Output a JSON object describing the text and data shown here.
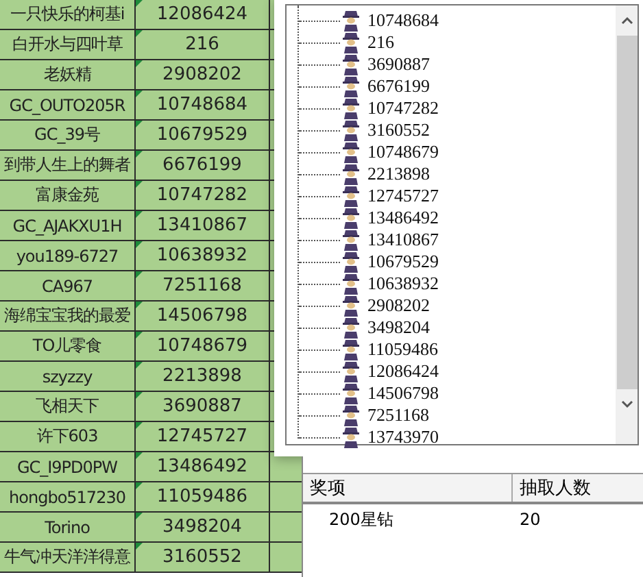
{
  "sheet": {
    "rows": [
      {
        "name": "一只快乐的柯基i",
        "id": "12086424"
      },
      {
        "name": "白开水与四叶草",
        "id": "216"
      },
      {
        "name": "老妖精",
        "id": "2908202"
      },
      {
        "name": "GC_OUTO205R",
        "id": "10748684"
      },
      {
        "name": "GC_39号",
        "id": "10679529"
      },
      {
        "name": "到带人生上的舞者",
        "id": "6676199"
      },
      {
        "name": "富康金苑",
        "id": "10747282"
      },
      {
        "name": "GC_AJAKXU1H",
        "id": "13410867"
      },
      {
        "name": "you189-6727",
        "id": "10638932"
      },
      {
        "name": "CA967",
        "id": "7251168"
      },
      {
        "name": "海绵宝宝我的最爱",
        "id": "14506798"
      },
      {
        "name": "TO儿零食",
        "id": "10748679"
      },
      {
        "name": "szyzzy",
        "id": "2213898"
      },
      {
        "name": "飞相天下",
        "id": "3690887"
      },
      {
        "name": "许下603",
        "id": "12745727"
      },
      {
        "name": "GC_I9PD0PW",
        "id": "13486492"
      },
      {
        "name": "hongbo517230",
        "id": "11059486"
      },
      {
        "name": "Torino",
        "id": "3498204"
      },
      {
        "name": "牛气冲天洋洋得意",
        "id": "3160552"
      }
    ]
  },
  "tree": {
    "items": [
      "10748684",
      "216",
      "3690887",
      "6676199",
      "10747282",
      "3160552",
      "10748679",
      "2213898",
      "12745727",
      "13486492",
      "13410867",
      "10679529",
      "10638932",
      "2908202",
      "3498204",
      "11059486",
      "12086424",
      "14506798",
      "7251168",
      "13743970"
    ]
  },
  "prizes": {
    "columns": [
      "奖项",
      "抽取人数"
    ],
    "rows": [
      {
        "prize": "200星钻",
        "count": "20"
      }
    ]
  }
}
